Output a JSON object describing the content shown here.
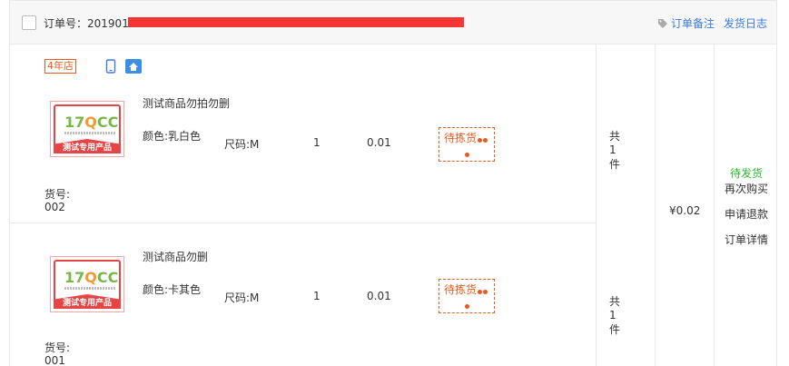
{
  "order": {
    "number_label": "订单号：",
    "number_visible": "201901",
    "links": {
      "remark": "订单备注",
      "log": "发货日志"
    }
  },
  "shop": {
    "badge": "4年店"
  },
  "items": [
    {
      "title": "测试商品勿拍勿删",
      "color": "颜色:乳白色",
      "size": "尺码:M",
      "qty": "1",
      "price": "0.01",
      "status": "待拣货",
      "sku_label": "货号:",
      "sku": "002",
      "count": "共1件",
      "image": {
        "logo": "17QCC",
        "footer": "测试专用产品"
      }
    },
    {
      "title": "测试商品勿删",
      "color": "颜色:卡其色",
      "size": "尺码:M",
      "qty": "1",
      "price": "0.01",
      "status": "待拣货",
      "sku_label": "货号:",
      "sku": "001",
      "count": "共1件",
      "image": {
        "logo": "17QCC",
        "footer": "测试专用产品"
      }
    }
  ],
  "summary": {
    "total": "¥0.02",
    "status": "待发货",
    "actions": [
      "再次购买",
      "申请退款",
      "订单详情"
    ]
  },
  "colors": {
    "accent": "#e85a1e",
    "link": "#3b7be0",
    "success": "#2db82d",
    "redaction": "#f53434"
  }
}
